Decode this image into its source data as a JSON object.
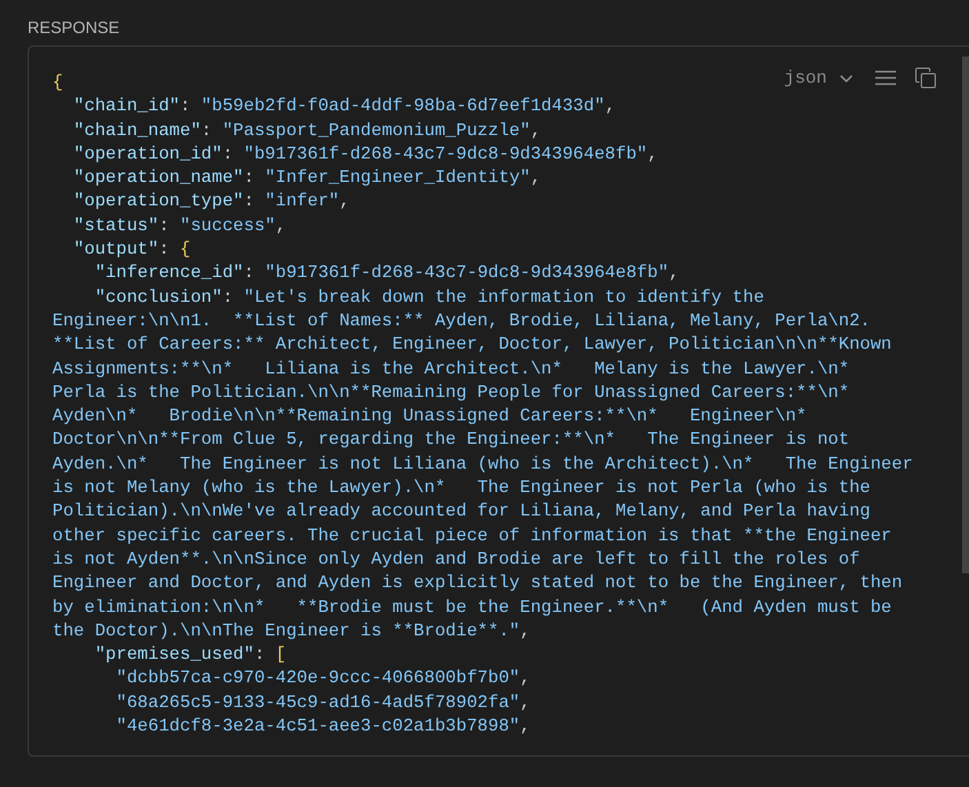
{
  "section_label": "RESPONSE",
  "toolbar": {
    "language": "json"
  },
  "code_lines": [
    {
      "parts": [
        {
          "kind": "brace",
          "text": "{"
        }
      ]
    },
    {
      "parts": [
        {
          "kind": "key",
          "text": "  \"chain_id\""
        },
        {
          "kind": "punct",
          "text": ": "
        },
        {
          "kind": "string",
          "text": "\"b59eb2fd-f0ad-4ddf-98ba-6d7eef1d433d\""
        },
        {
          "kind": "punct",
          "text": ","
        }
      ]
    },
    {
      "parts": [
        {
          "kind": "key",
          "text": "  \"chain_name\""
        },
        {
          "kind": "punct",
          "text": ": "
        },
        {
          "kind": "string",
          "text": "\"Passport_Pandemonium_Puzzle\""
        },
        {
          "kind": "punct",
          "text": ","
        }
      ]
    },
    {
      "parts": [
        {
          "kind": "key",
          "text": "  \"operation_id\""
        },
        {
          "kind": "punct",
          "text": ": "
        },
        {
          "kind": "string",
          "text": "\"b917361f-d268-43c7-9dc8-9d343964e8fb\""
        },
        {
          "kind": "punct",
          "text": ","
        }
      ]
    },
    {
      "parts": [
        {
          "kind": "key",
          "text": "  \"operation_name\""
        },
        {
          "kind": "punct",
          "text": ": "
        },
        {
          "kind": "string",
          "text": "\"Infer_Engineer_Identity\""
        },
        {
          "kind": "punct",
          "text": ","
        }
      ]
    },
    {
      "parts": [
        {
          "kind": "key",
          "text": "  \"operation_type\""
        },
        {
          "kind": "punct",
          "text": ": "
        },
        {
          "kind": "string",
          "text": "\"infer\""
        },
        {
          "kind": "punct",
          "text": ","
        }
      ]
    },
    {
      "parts": [
        {
          "kind": "key",
          "text": "  \"status\""
        },
        {
          "kind": "punct",
          "text": ": "
        },
        {
          "kind": "string",
          "text": "\"success\""
        },
        {
          "kind": "punct",
          "text": ","
        }
      ]
    },
    {
      "parts": [
        {
          "kind": "key",
          "text": "  \"output\""
        },
        {
          "kind": "punct",
          "text": ": "
        },
        {
          "kind": "brace",
          "text": "{"
        }
      ]
    },
    {
      "parts": [
        {
          "kind": "key",
          "text": "    \"inference_id\""
        },
        {
          "kind": "punct",
          "text": ": "
        },
        {
          "kind": "string",
          "text": "\"b917361f-d268-43c7-9dc8-9d343964e8fb\""
        },
        {
          "kind": "punct",
          "text": ","
        }
      ]
    },
    {
      "parts": [
        {
          "kind": "key",
          "text": "    \"conclusion\""
        },
        {
          "kind": "punct",
          "text": ": "
        },
        {
          "kind": "string",
          "text": "\"Let's break down the information to identify the"
        }
      ]
    },
    {
      "parts": [
        {
          "kind": "string",
          "text": "Engineer:\\n\\n1.  **List of Names:** Ayden, Brodie, Liliana, Melany, Perla\\n2."
        }
      ]
    },
    {
      "parts": [
        {
          "kind": "string",
          "text": "**List of Careers:** Architect, Engineer, Doctor, Lawyer, Politician\\n\\n**Known"
        }
      ]
    },
    {
      "parts": [
        {
          "kind": "string",
          "text": "Assignments:**\\n*   Liliana is the Architect.\\n*   Melany is the Lawyer.\\n*"
        }
      ]
    },
    {
      "parts": [
        {
          "kind": "string",
          "text": "Perla is the Politician.\\n\\n**Remaining People for Unassigned Careers:**\\n*"
        }
      ]
    },
    {
      "parts": [
        {
          "kind": "string",
          "text": "Ayden\\n*   Brodie\\n\\n**Remaining Unassigned Careers:**\\n*   Engineer\\n*"
        }
      ]
    },
    {
      "parts": [
        {
          "kind": "string",
          "text": "Doctor\\n\\n**From Clue 5, regarding the Engineer:**\\n*   The Engineer is not"
        }
      ]
    },
    {
      "parts": [
        {
          "kind": "string",
          "text": "Ayden.\\n*   The Engineer is not Liliana (who is the Architect).\\n*   The Engineer"
        }
      ]
    },
    {
      "parts": [
        {
          "kind": "string",
          "text": "is not Melany (who is the Lawyer).\\n*   The Engineer is not Perla (who is the"
        }
      ]
    },
    {
      "parts": [
        {
          "kind": "string",
          "text": "Politician).\\n\\nWe've already accounted for Liliana, Melany, and Perla having"
        }
      ]
    },
    {
      "parts": [
        {
          "kind": "string",
          "text": "other specific careers. The crucial piece of information is that **the Engineer"
        }
      ]
    },
    {
      "parts": [
        {
          "kind": "string",
          "text": "is not Ayden**.\\n\\nSince only Ayden and Brodie are left to fill the roles of"
        }
      ]
    },
    {
      "parts": [
        {
          "kind": "string",
          "text": "Engineer and Doctor, and Ayden is explicitly stated not to be the Engineer, then"
        }
      ]
    },
    {
      "parts": [
        {
          "kind": "string",
          "text": "by elimination:\\n\\n*   **Brodie must be the Engineer.**\\n*   (And Ayden must be"
        }
      ]
    },
    {
      "parts": [
        {
          "kind": "string",
          "text": "the Doctor).\\n\\nThe Engineer is **Brodie**.\""
        },
        {
          "kind": "punct",
          "text": ","
        }
      ]
    },
    {
      "parts": [
        {
          "kind": "key",
          "text": "    \"premises_used\""
        },
        {
          "kind": "punct",
          "text": ": "
        },
        {
          "kind": "brace",
          "text": "["
        }
      ]
    },
    {
      "parts": [
        {
          "kind": "string",
          "text": "      \"dcbb57ca-c970-420e-9ccc-4066800bf7b0\""
        },
        {
          "kind": "punct",
          "text": ","
        }
      ]
    },
    {
      "parts": [
        {
          "kind": "string",
          "text": "      \"68a265c5-9133-45c9-ad16-4ad5f78902fa\""
        },
        {
          "kind": "punct",
          "text": ","
        }
      ]
    },
    {
      "parts": [
        {
          "kind": "string",
          "text": "      \"4e61dcf8-3e2a-4c51-aee3-c02a1b3b7898\""
        },
        {
          "kind": "punct",
          "text": ","
        }
      ]
    }
  ]
}
